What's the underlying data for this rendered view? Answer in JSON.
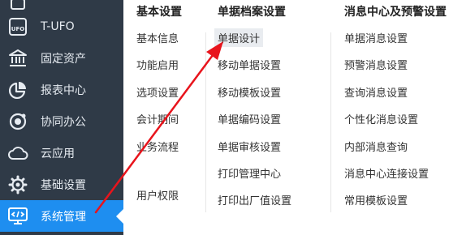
{
  "sidebar": {
    "items": [
      {
        "label": "",
        "icon": "partial-icon"
      },
      {
        "label": "T-UFO",
        "icon": "ufo-icon"
      },
      {
        "label": "固定资产",
        "icon": "bank-icon"
      },
      {
        "label": "报表中心",
        "icon": "pie-chart-icon"
      },
      {
        "label": "协同办公",
        "icon": "collaboration-icon"
      },
      {
        "label": "云应用",
        "icon": "cloud-icon"
      },
      {
        "label": "基础设置",
        "icon": "gear-icon"
      },
      {
        "label": "系统管理",
        "icon": "monitor-code-icon",
        "active": true
      }
    ]
  },
  "menu": {
    "columns": [
      {
        "title": "基本设置",
        "items": [
          "基本信息",
          "功能启用",
          "选项设置",
          "会计期间",
          "业务流程",
          "用户权限"
        ]
      },
      {
        "title": "单据档案设置",
        "items": [
          "单据设计",
          "移动单据设置",
          "移动模板设置",
          "单据编码设置",
          "单据审核设置",
          "打印管理中心",
          "打印出厂值设置"
        ]
      },
      {
        "title": "消息中心及预警设置",
        "items": [
          "单据消息设置",
          "预警消息设置",
          "查询消息设置",
          "个性化消息设置",
          "内部消息查询",
          "消息中心连接设置",
          "常用模板设置"
        ]
      }
    ]
  },
  "colors": {
    "sidebar_bg": "#2f3a47",
    "active_bg": "#1e8ef0",
    "annotation_arrow": "#e8141c"
  }
}
